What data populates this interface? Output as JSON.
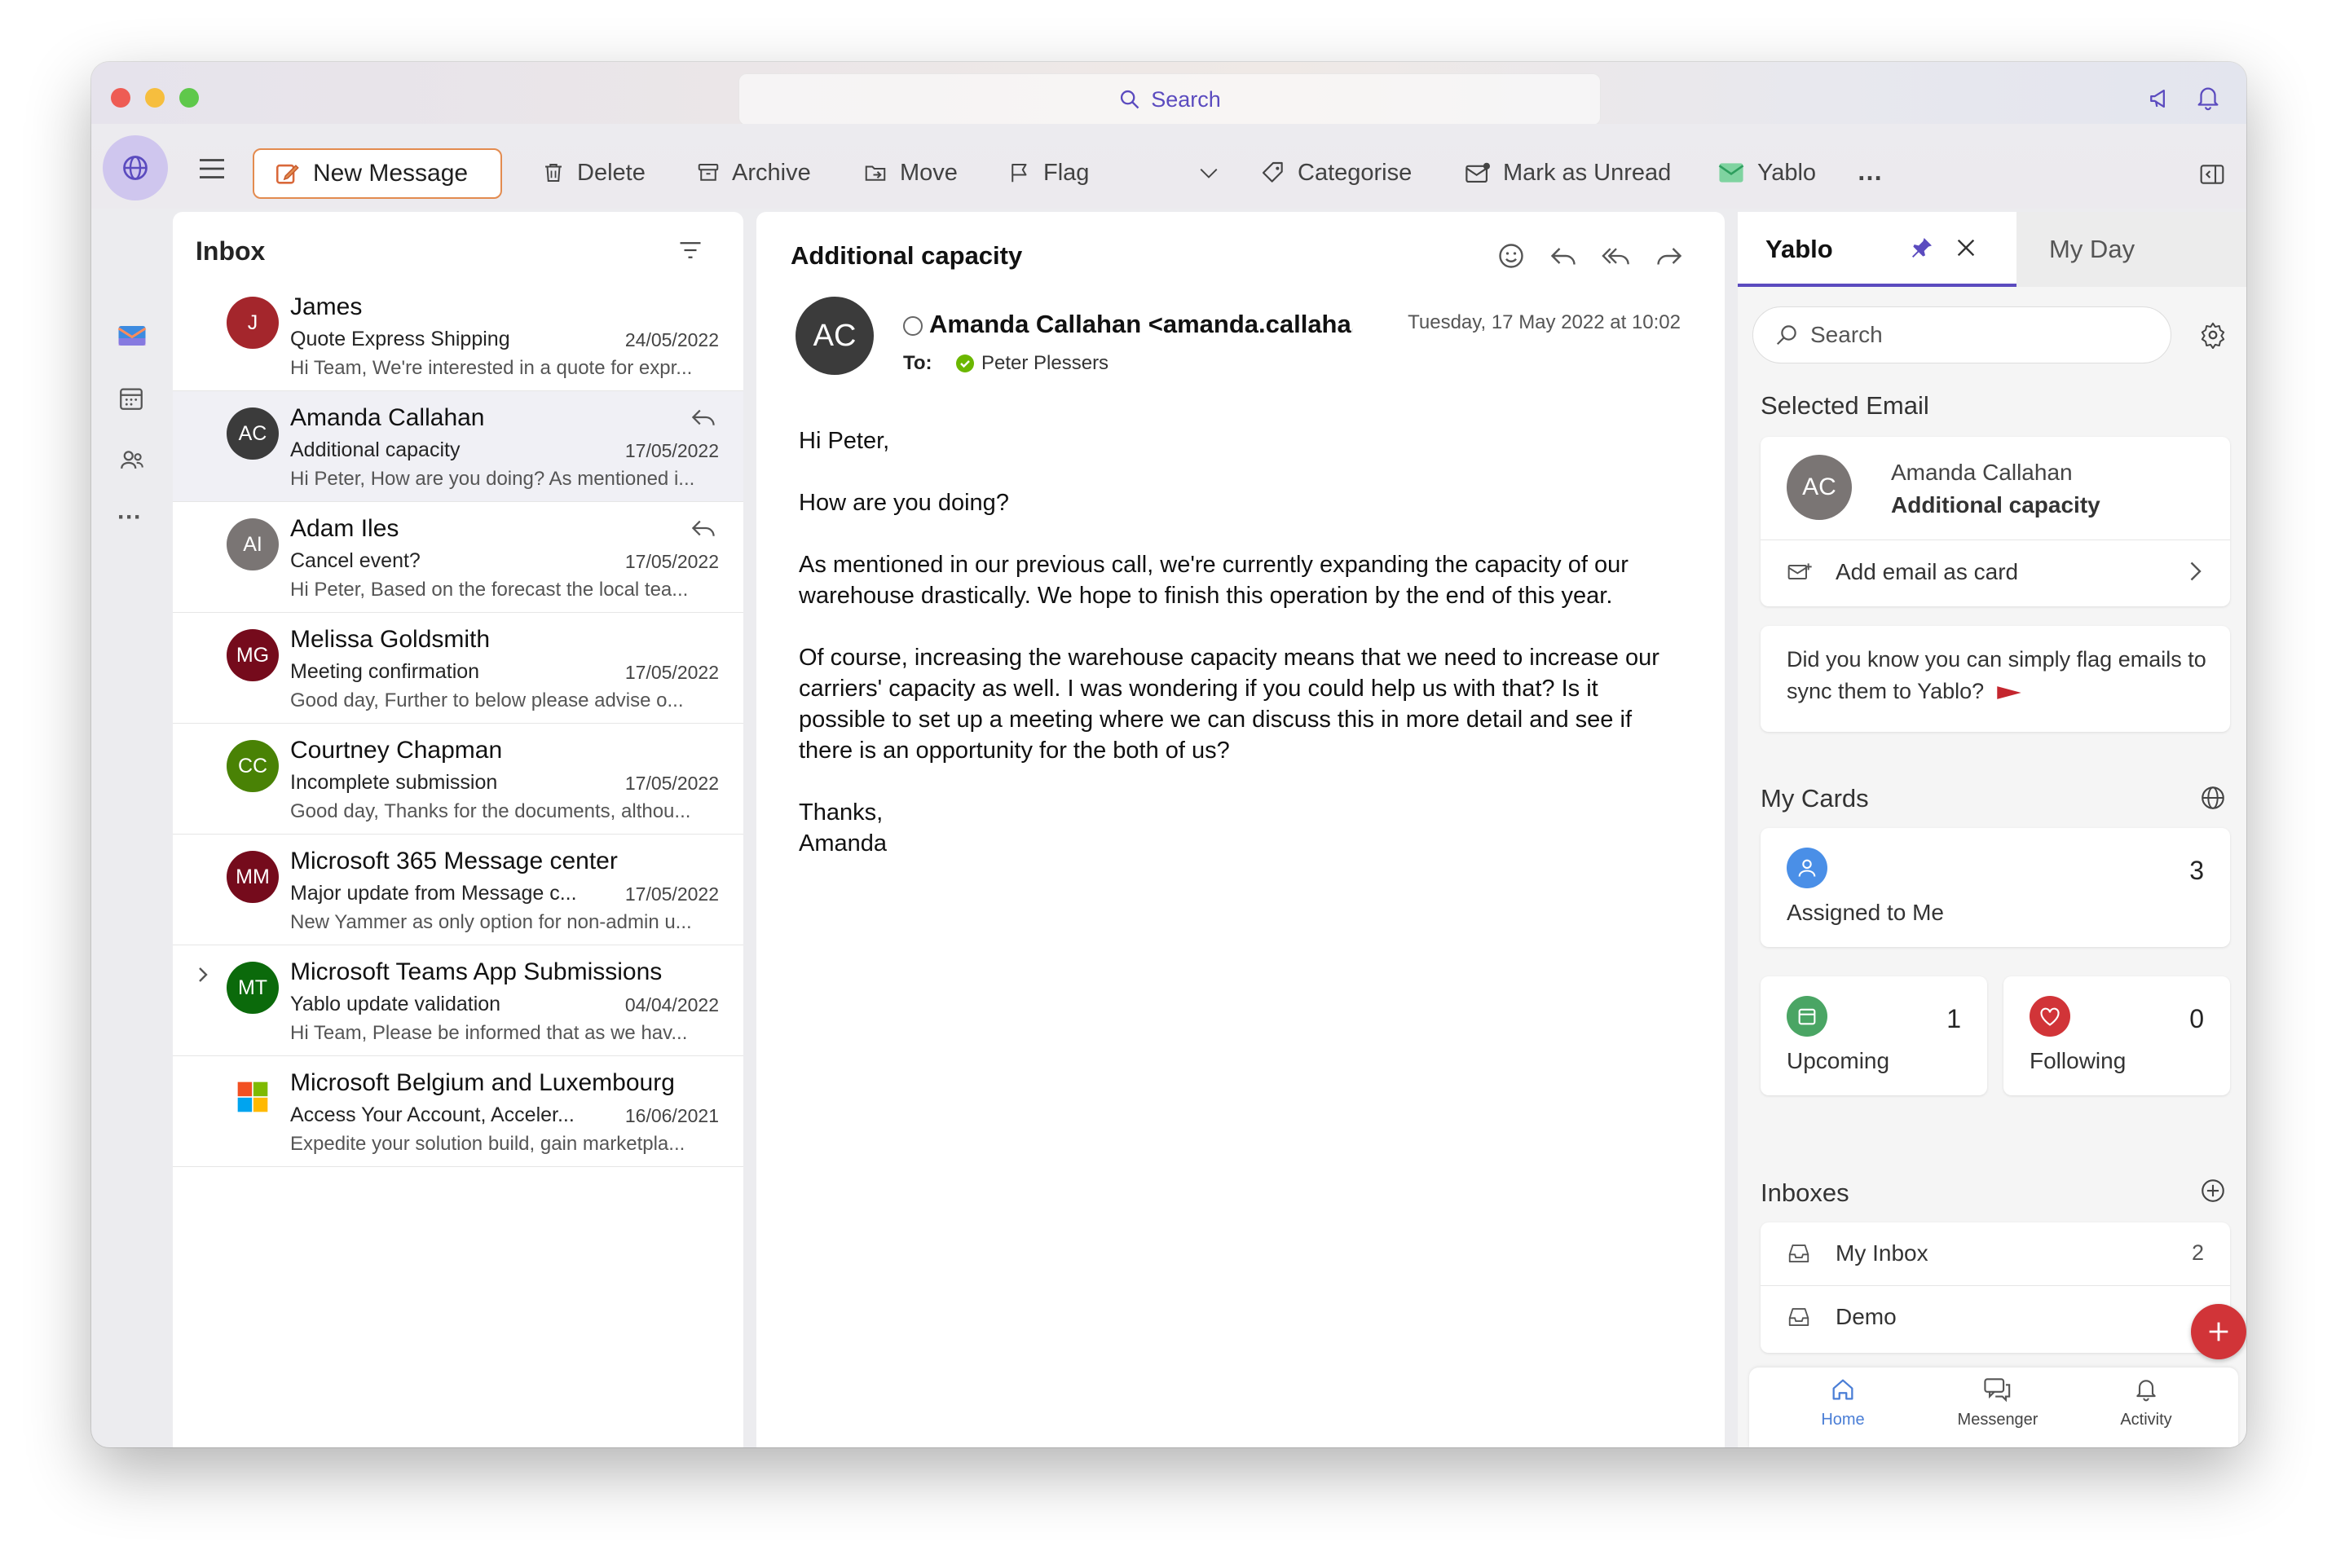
{
  "search": {
    "placeholder": "Search"
  },
  "toolbar": {
    "new_message": "New Message",
    "delete": "Delete",
    "archive": "Archive",
    "move": "Move",
    "flag": "Flag",
    "categorise": "Categorise",
    "mark_unread": "Mark as Unread",
    "yablo": "Yablo",
    "more": "…"
  },
  "inbox": {
    "title": "Inbox",
    "items": [
      {
        "initials": "J",
        "color": "#a4262c",
        "sender": "James",
        "subject": "Quote Express Shipping",
        "date": "24/05/2022",
        "preview": "Hi Team, We're interested in a quote for expr..."
      },
      {
        "initials": "AC",
        "color": "#3b3b3b",
        "sender": "Amanda Callahan",
        "subject": "Additional capacity",
        "date": "17/05/2022",
        "preview": "Hi Peter, How are you doing? As mentioned i..."
      },
      {
        "initials": "AI",
        "color": "#7a7574",
        "sender": "Adam Iles",
        "subject": "Cancel event?",
        "date": "17/05/2022",
        "preview": "Hi Peter, Based on the forecast the local tea..."
      },
      {
        "initials": "MG",
        "color": "#750b1c",
        "sender": "Melissa Goldsmith",
        "subject": "Meeting confirmation",
        "date": "17/05/2022",
        "preview": "Good day, Further to below please advise o..."
      },
      {
        "initials": "CC",
        "color": "#498205",
        "sender": "Courtney Chapman",
        "subject": "Incomplete submission",
        "date": "17/05/2022",
        "preview": "Good day, Thanks for the documents, althou..."
      },
      {
        "initials": "MM",
        "color": "#750b1c",
        "sender": "Microsoft 365 Message center",
        "subject": "Major update from Message c...",
        "date": "17/05/2022",
        "preview": "New Yammer as only option for non-admin u..."
      },
      {
        "initials": "MT",
        "color": "#0b6a0b",
        "sender": "Microsoft Teams App Submissions",
        "subject": "Yablo update validation",
        "date": "04/04/2022",
        "preview": "Hi Team, Please be informed that as we hav..."
      },
      {
        "initials": "",
        "color": "#ffffff",
        "sender": "Microsoft Belgium and Luxembourg",
        "subject": "Access Your Account, Acceler...",
        "date": "16/06/2021",
        "preview": "Expedite your solution build, gain marketpla..."
      }
    ]
  },
  "reading": {
    "subject": "Additional capacity",
    "avatar_initials": "AC",
    "from": "Amanda Callahan <amanda.callaha...",
    "datetime": "Tuesday, 17 May 2022 at 10:02",
    "to_label": "To:",
    "to": "Peter Plessers",
    "body": [
      "Hi Peter,",
      "How are you doing?",
      "As mentioned in our previous call, we're currently expanding the capacity of our warehouse drastically. We hope to finish this operation by the end of this year.",
      "Of course, increasing the warehouse capacity means that we need to increase our carriers' capacity as well. I was wondering if you could help us with that? Is it possible to set up a meeting where we can discuss this in more detail and see if there is an opportunity for the both of us?",
      "Thanks,",
      "Amanda"
    ]
  },
  "yablo": {
    "tab_yablo": "Yablo",
    "tab_myday": "My Day",
    "search_placeholder": "Search",
    "selected_email_title": "Selected Email",
    "selected_initials": "AC",
    "selected_sender": "Amanda Callahan",
    "selected_subject": "Additional capacity",
    "add_email_card": "Add email as card",
    "tip": "Did you know you can simply flag emails to sync them to Yablo?",
    "my_cards_title": "My Cards",
    "assigned_label": "Assigned to Me",
    "assigned_count": "3",
    "upcoming_label": "Upcoming",
    "upcoming_count": "1",
    "following_label": "Following",
    "following_count": "0",
    "inboxes_title": "Inboxes",
    "inbox_items": [
      {
        "name": "My Inbox",
        "count": "2"
      },
      {
        "name": "Demo",
        "count": ""
      }
    ],
    "nav_home": "Home",
    "nav_messenger": "Messenger",
    "nav_activity": "Activity"
  },
  "colors": {
    "accent": "#5b4bbf",
    "new_message_border": "#e38b4f",
    "fab": "#d13438"
  }
}
